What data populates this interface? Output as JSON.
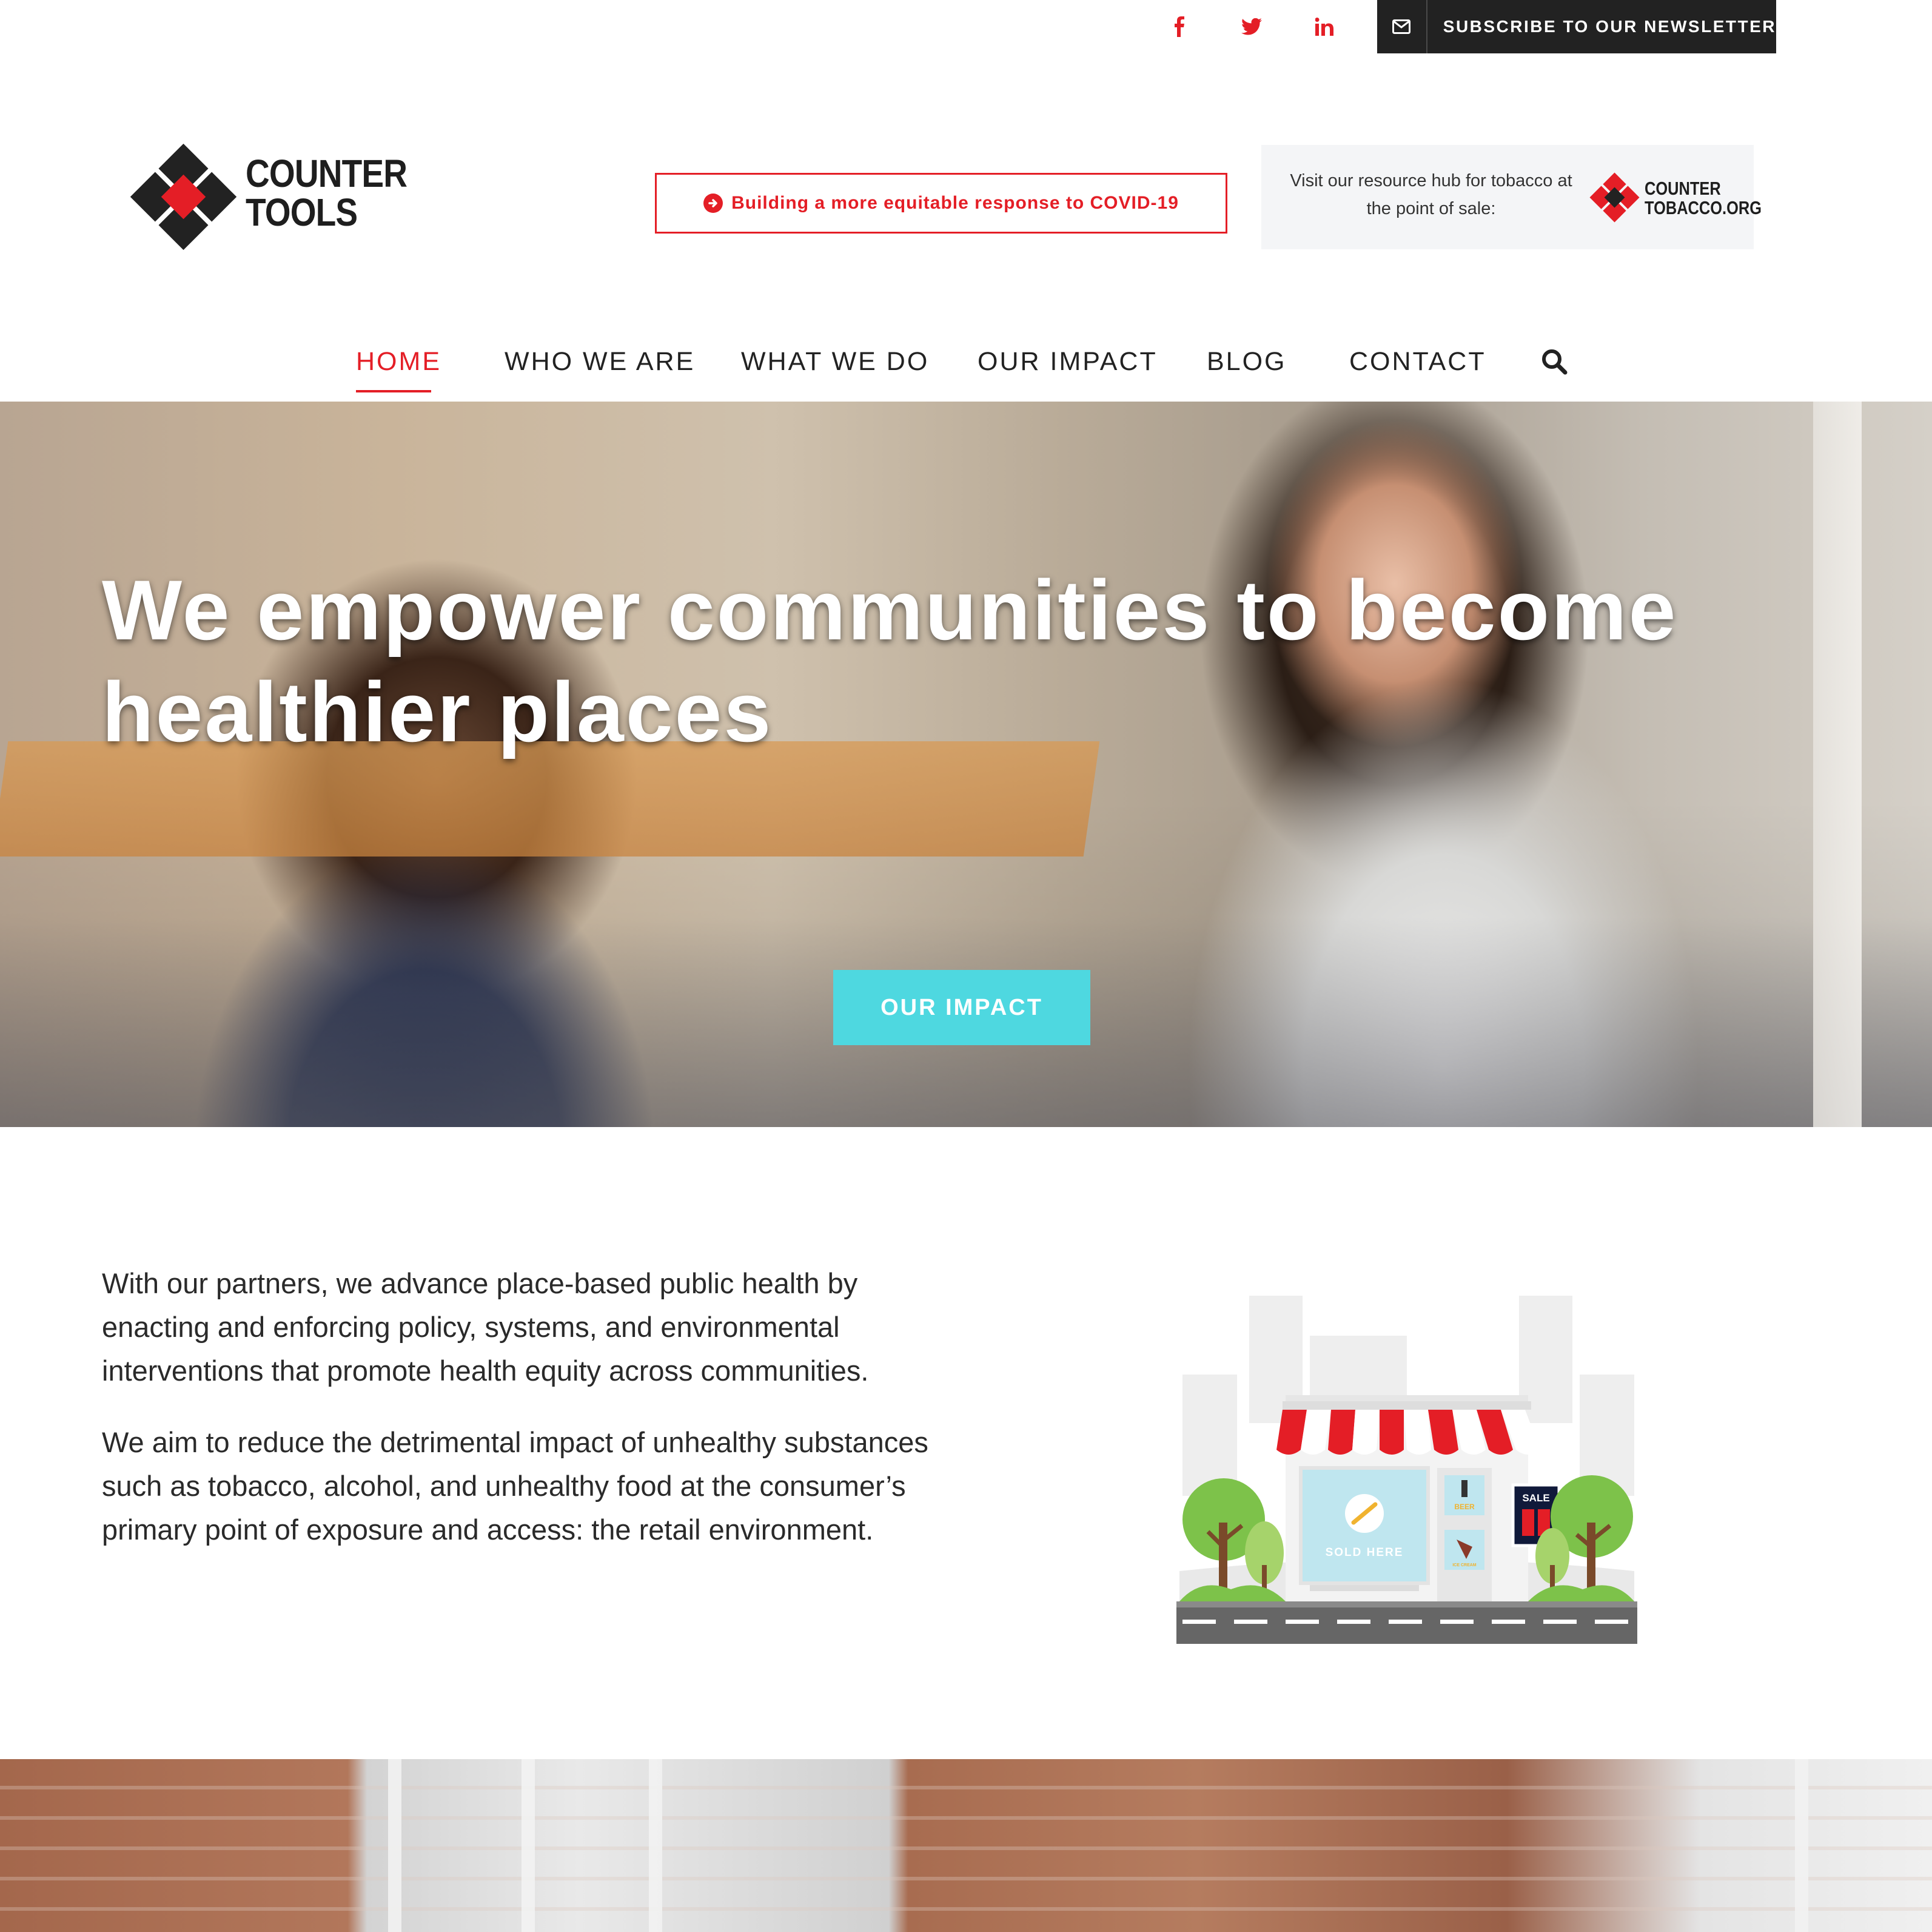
{
  "topbar": {
    "social": [
      {
        "name": "facebook-icon",
        "glyph": "f"
      },
      {
        "name": "twitter-icon",
        "glyph": "twitter"
      },
      {
        "name": "linkedin-icon",
        "glyph": "in"
      }
    ],
    "newsletter_label": "SUBSCRIBE TO OUR NEWSLETTER"
  },
  "header": {
    "logo_line1": "COUNTER",
    "logo_line2": "TOOLS",
    "covid_link": "Building a more equitable response to COVID-19",
    "hub_text": "Visit our resource hub for tobacco at the point of sale:",
    "hub_logo_line1": "COUNTER",
    "hub_logo_line2": "TOBACCO.ORG"
  },
  "nav": {
    "items": [
      "HOME",
      "WHO WE ARE",
      "WHAT WE DO",
      "OUR IMPACT",
      "BLOG",
      "CONTACT"
    ],
    "active": "HOME"
  },
  "hero": {
    "title": "We empower communities to become healthier places",
    "button": "OUR IMPACT"
  },
  "intro": {
    "p1": "With our partners, we advance place-based public health by enacting and enforcing policy, systems, and environmental interventions that promote health equity across communities.",
    "p2": "We aim to reduce the detrimental impact of unhealthy substances such as tobacco, alcohol, and unhealthy food at the consumer’s primary point of exposure and access: the retail environment."
  },
  "illustration": {
    "window_text": "SOLD HERE",
    "sale_text": "SALE",
    "beer_text": "BEER",
    "ice_cream_text": "ICE CREAM"
  },
  "colors": {
    "brand_red": "#e41e26",
    "accent_cyan": "#4ed8e0",
    "dark": "#222222"
  }
}
